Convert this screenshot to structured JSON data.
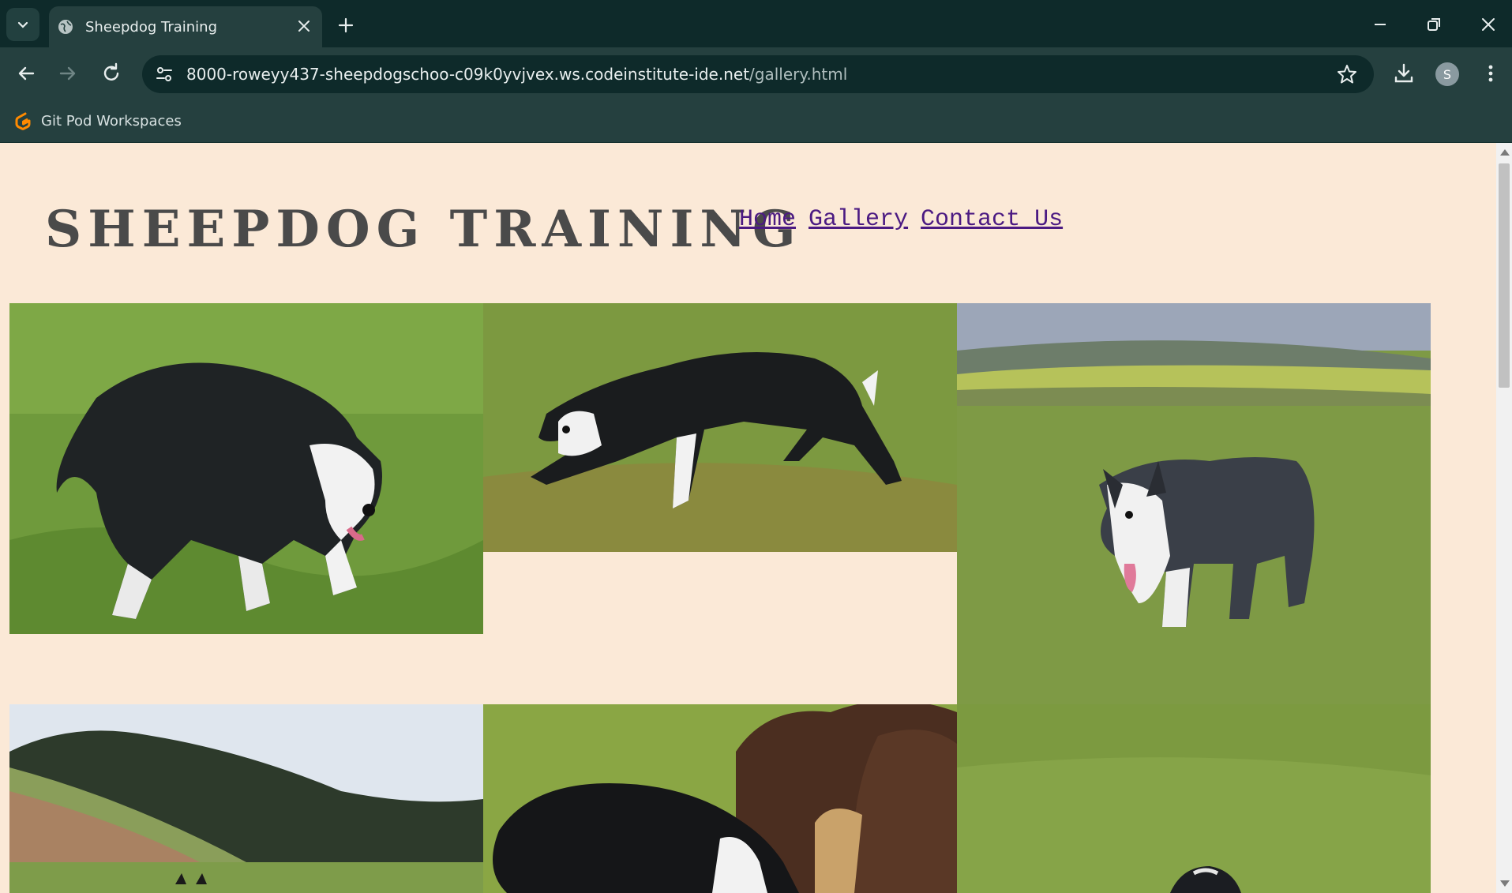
{
  "browser": {
    "tab_title": "Sheepdog Training",
    "url_host": "8000-roweyy437-sheepdogschoo-c09k0yvjvex.ws.codeinstitute-ide.net",
    "url_path": "/gallery.html",
    "profile_initial": "S",
    "bookmark_label": "Git Pod Workspaces"
  },
  "page": {
    "site_title": "SHEEPDOG TRAINING",
    "nav": [
      "Home",
      "Gallery",
      "Contact Us"
    ]
  },
  "colors": {
    "page_background": "#fbe9d7",
    "nav_link": "#4b1a82",
    "title": "#4a4a4a",
    "browser_frame": "#0e2a2a"
  }
}
